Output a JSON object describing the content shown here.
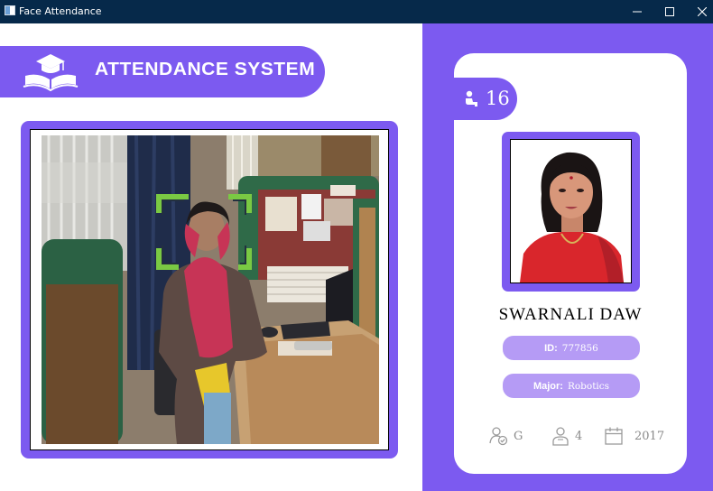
{
  "window": {
    "title": "Face Attendance",
    "controls": [
      "minimize",
      "maximize",
      "close"
    ]
  },
  "header": {
    "title": "ATTENDANCE SYSTEM",
    "logo_icon": "open-book-graduation-cap-icon"
  },
  "camera": {
    "detection_box_color": "#7ac943"
  },
  "student": {
    "attendance_count": "16",
    "name": "SWARNALI  DAW",
    "id_label": "ID:",
    "id_value": "777856",
    "major_label": "Major:",
    "major_value": "Robotics",
    "standing": "G",
    "year": "4",
    "starting_year": "2017"
  },
  "colors": {
    "accent": "#7c5af0",
    "pill": "#b59bf5",
    "titlebar": "#06294a"
  }
}
